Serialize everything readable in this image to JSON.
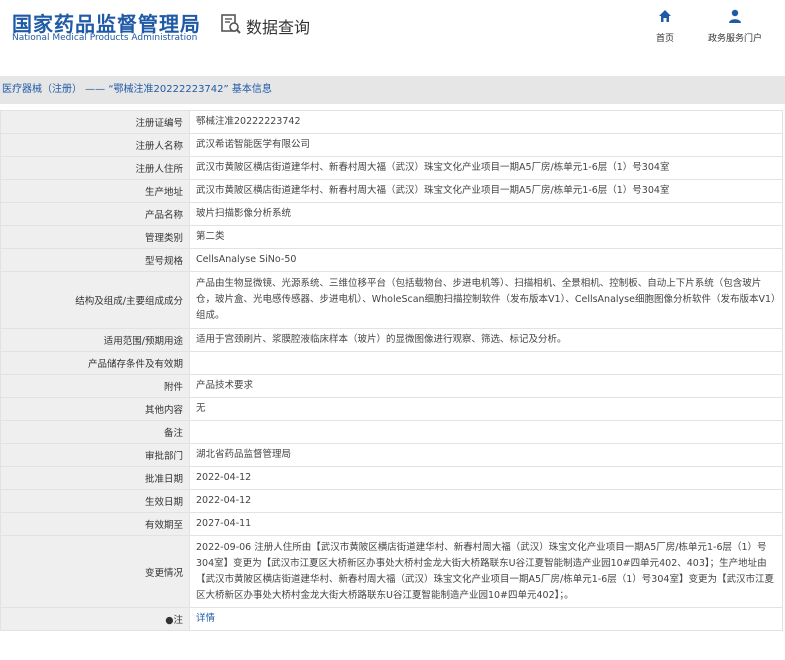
{
  "header": {
    "logo_cn": "国家药品监督管理局",
    "logo_en": "National Medical Products Administration",
    "search_label": "数据查询",
    "nav_home": "首页",
    "nav_service": "政务服务门户"
  },
  "breadcrumb": "医疗器械（注册） —— “鄂械注准20222223742” 基本信息",
  "rows": [
    {
      "key": "注册证编号",
      "val": "鄂械注准20222223742"
    },
    {
      "key": "注册人名称",
      "val": "武汉希诺智能医学有限公司"
    },
    {
      "key": "注册人住所",
      "val": "武汉市黄陂区横店街道建华村、新春村周大福（武汉）珠宝文化产业项目一期A5厂房/栋单元1-6层（1）号304室"
    },
    {
      "key": "生产地址",
      "val": "武汉市黄陂区横店街道建华村、新春村周大福（武汉）珠宝文化产业项目一期A5厂房/栋单元1-6层（1）号304室"
    },
    {
      "key": "产品名称",
      "val": "玻片扫描影像分析系统"
    },
    {
      "key": "管理类别",
      "val": "第二类"
    },
    {
      "key": "型号规格",
      "val": "CellsAnalyse SiNo-50"
    },
    {
      "key": "结构及组成/主要组成成分",
      "val": "产品由生物显微镜、光源系统、三维位移平台（包括载物台、步进电机等）、扫描相机、全景相机、控制板、自动上下片系统（包含玻片仓，玻片盒、光电感传感器、步进电机）、WholeScan细胞扫描控制软件（发布版本V1）、CellsAnalyse细胞图像分析软件（发布版本V1）组成。"
    },
    {
      "key": "适用范围/预期用途",
      "val": "适用于宫颈刷片、浆膜腔液临床样本（玻片）的显微图像进行观察、筛选、标记及分析。"
    },
    {
      "key": "产品储存条件及有效期",
      "val": ""
    },
    {
      "key": "附件",
      "val": "产品技术要求"
    },
    {
      "key": "其他内容",
      "val": "无"
    },
    {
      "key": "备注",
      "val": ""
    },
    {
      "key": "审批部门",
      "val": "湖北省药品监督管理局"
    },
    {
      "key": "批准日期",
      "val": "2022-04-12"
    },
    {
      "key": "生效日期",
      "val": "2022-04-12"
    },
    {
      "key": "有效期至",
      "val": "2027-04-11"
    },
    {
      "key": "变更情况",
      "val": "2022-09-06 注册人住所由【武汉市黄陂区横店街道建华村、新春村周大福（武汉）珠宝文化产业项目一期A5厂房/栋单元1-6层（1）号304室】变更为【武汉市江夏区大桥新区办事处大桥村金龙大街大桥路联东U谷江夏智能制造产业园10#四单元402、403】；生产地址由【武汉市黄陂区横店街道建华村、新春村周大福（武汉）珠宝文化产业项目一期A5厂房/栋单元1-6层（1）号304室】变更为【武汉市江夏区大桥新区办事处大桥村金龙大街大桥路联东U谷江夏智能制造产业园10#四单元402】；。"
    }
  ],
  "note": {
    "key": "●注",
    "link": "详情"
  },
  "colors": {
    "brand": "#1f5aa6",
    "key_bg": "#efefef",
    "bar_bg": "#e6e6e6"
  }
}
